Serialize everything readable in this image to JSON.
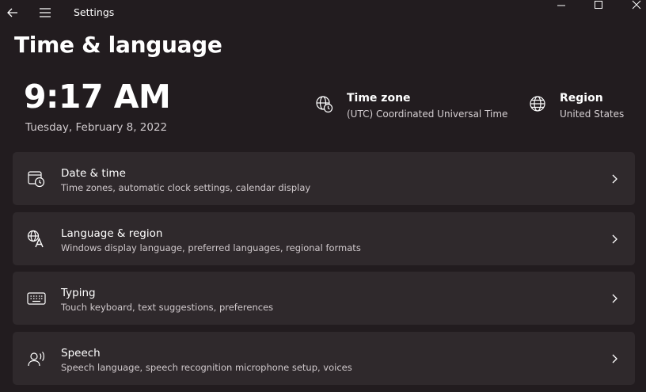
{
  "window": {
    "title": "Settings"
  },
  "page": {
    "title": "Time & language"
  },
  "clock": {
    "time": "9:17 AM",
    "date": "Tuesday, February 8, 2022"
  },
  "time_zone": {
    "title": "Time zone",
    "value": "(UTC) Coordinated Universal Time",
    "icon": "globe-clock-icon"
  },
  "region": {
    "title": "Region",
    "value": "United States",
    "icon": "globe-icon"
  },
  "cards": [
    {
      "title": "Date & time",
      "subtitle": "Time zones, automatic clock settings, calendar display",
      "icon": "calendar-clock-icon"
    },
    {
      "title": "Language & region",
      "subtitle": "Windows display language, preferred languages, regional formats",
      "icon": "language-icon"
    },
    {
      "title": "Typing",
      "subtitle": "Touch keyboard, text suggestions, preferences",
      "icon": "keyboard-icon"
    },
    {
      "title": "Speech",
      "subtitle": "Speech language, speech recognition microphone setup, voices",
      "icon": "speech-icon"
    }
  ],
  "colors": {
    "background": "#221c1f",
    "card": "#2f292c",
    "text": "#ffffff",
    "subtext": "#cfc8cb"
  }
}
